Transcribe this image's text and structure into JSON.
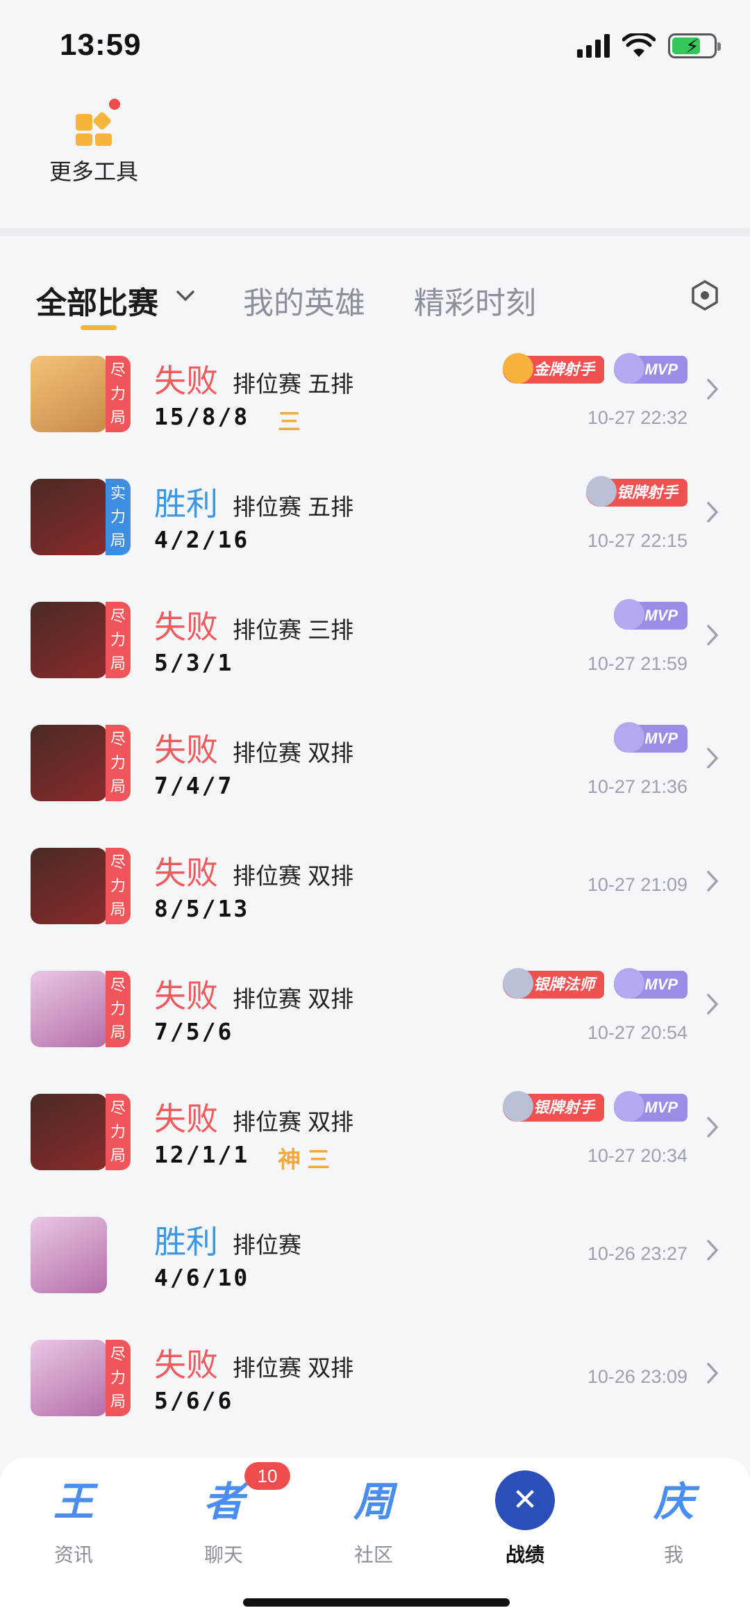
{
  "status": {
    "time": "13:59"
  },
  "tools": {
    "label": "更多工具"
  },
  "tabs": [
    {
      "label": "全部比赛"
    },
    {
      "label": "我的英雄"
    },
    {
      "label": "精彩时刻"
    }
  ],
  "matches": [
    {
      "tag": [
        "尽",
        "力",
        "局"
      ],
      "result": "失败",
      "mode": "排位赛 五排",
      "kda": "15/8/8",
      "extra": "三",
      "badges": [
        {
          "type": "gold",
          "text": "金牌射手"
        },
        {
          "type": "mvp",
          "text": "MVP"
        }
      ],
      "time": "10-27 22:32"
    },
    {
      "tag": [
        "实",
        "力",
        "局"
      ],
      "result": "胜利",
      "mode": "排位赛 五排",
      "kda": "4/2/16",
      "extra": "",
      "badges": [
        {
          "type": "silver",
          "text": "银牌射手"
        }
      ],
      "time": "10-27 22:15"
    },
    {
      "tag": [
        "尽",
        "力",
        "局"
      ],
      "result": "失败",
      "mode": "排位赛 三排",
      "kda": "5/3/1",
      "extra": "",
      "badges": [
        {
          "type": "mvp",
          "text": "MVP"
        }
      ],
      "time": "10-27 21:59"
    },
    {
      "tag": [
        "尽",
        "力",
        "局"
      ],
      "result": "失败",
      "mode": "排位赛 双排",
      "kda": "7/4/7",
      "extra": "",
      "badges": [
        {
          "type": "mvp",
          "text": "MVP"
        }
      ],
      "time": "10-27 21:36"
    },
    {
      "tag": [
        "尽",
        "力",
        "局"
      ],
      "result": "失败",
      "mode": "排位赛 双排",
      "kda": "8/5/13",
      "extra": "",
      "badges": [],
      "time": "10-27 21:09"
    },
    {
      "tag": [
        "尽",
        "力",
        "局"
      ],
      "result": "失败",
      "mode": "排位赛 双排",
      "kda": "7/5/6",
      "extra": "",
      "badges": [
        {
          "type": "silver",
          "text": "银牌法师"
        },
        {
          "type": "mvp",
          "text": "MVP"
        }
      ],
      "time": "10-27 20:54"
    },
    {
      "tag": [
        "尽",
        "力",
        "局"
      ],
      "result": "失败",
      "mode": "排位赛 双排",
      "kda": "12/1/1",
      "extra": "神 三",
      "badges": [
        {
          "type": "silver",
          "text": "银牌射手"
        },
        {
          "type": "mvp",
          "text": "MVP"
        }
      ],
      "time": "10-27 20:34"
    },
    {
      "tag": [],
      "result": "胜利",
      "mode": "排位赛",
      "kda": "4/6/10",
      "extra": "",
      "badges": [],
      "time": "10-26 23:27"
    },
    {
      "tag": [
        "尽",
        "力",
        "局"
      ],
      "result": "失败",
      "mode": "排位赛 双排",
      "kda": "5/6/6",
      "extra": "",
      "badges": [],
      "time": "10-26 23:09"
    }
  ],
  "nav": [
    {
      "label": "资讯",
      "glyph": "王"
    },
    {
      "label": "聊天",
      "glyph": "者",
      "badge": "10"
    },
    {
      "label": "社区",
      "glyph": "周"
    },
    {
      "label": "战绩",
      "glyph": "✕"
    },
    {
      "label": "我",
      "glyph": "庆"
    }
  ],
  "colors": {
    "lose": "#ef5b5b",
    "win": "#3e96e0",
    "accent": "#f5b43c"
  }
}
